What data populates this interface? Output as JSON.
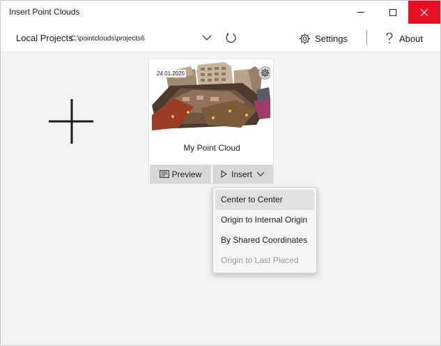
{
  "window": {
    "title": "Insert Point Clouds"
  },
  "toolbar": {
    "project_label": "Local Projects",
    "project_path": "C:\\pointclouds\\projects6",
    "settings_label": "Settings",
    "about_label": "About"
  },
  "card": {
    "date": "24.01.2025",
    "title": "My Point Cloud",
    "preview_label": "Preview",
    "insert_label": "Insert"
  },
  "insert_menu": {
    "items": [
      {
        "label": "Center to Center",
        "state": "hover"
      },
      {
        "label": "Origin to Internal Origin",
        "state": "enabled"
      },
      {
        "label": "By Shared Coordinates",
        "state": "enabled"
      },
      {
        "label": "Origin to Last Placed",
        "state": "disabled"
      }
    ]
  },
  "colors": {
    "close_button": "#e81123",
    "window_background": "#f3f3f3",
    "disabled_text": "#9a9a9a"
  }
}
